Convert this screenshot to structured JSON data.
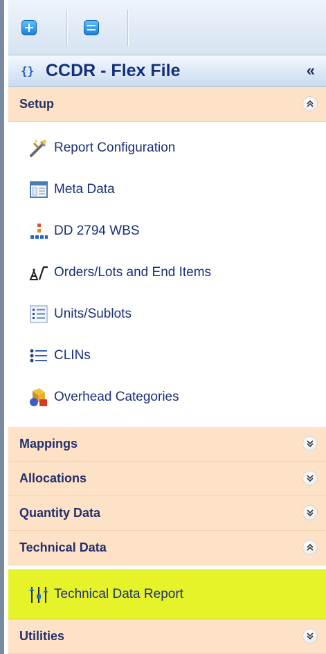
{
  "toolbar": {
    "buttons": [
      {
        "name": "expand-all-icon"
      },
      {
        "name": "collapse-all-icon"
      }
    ]
  },
  "panel": {
    "title": "CCDR - Flex File",
    "code_icon": "{}",
    "collapse_glyph": "«"
  },
  "sections": [
    {
      "label": "Setup",
      "expanded": true
    },
    {
      "label": "Mappings",
      "expanded": false
    },
    {
      "label": "Allocations",
      "expanded": false
    },
    {
      "label": "Quantity Data",
      "expanded": false
    },
    {
      "label": "Technical Data",
      "expanded": true
    },
    {
      "label": "Utilities",
      "expanded": false
    }
  ],
  "chevrons": {
    "up": "⌃",
    "down": "⌄"
  },
  "setup_items": [
    {
      "label": "Report Configuration",
      "icon": "tools-wand-icon"
    },
    {
      "label": "Meta Data",
      "icon": "window-grid-icon"
    },
    {
      "label": "DD 2794 WBS",
      "icon": "hierarchy-icon"
    },
    {
      "label": "Orders/Lots and End Items",
      "icon": "scale-chart-icon"
    },
    {
      "label": "Units/Sublots",
      "icon": "numbered-list-icon"
    },
    {
      "label": "CLINs",
      "icon": "bullet-list-icon"
    },
    {
      "label": "Overhead Categories",
      "icon": "shapes-icon"
    }
  ],
  "technical_items": [
    {
      "label": "Technical Data Report",
      "icon": "sliders-icon",
      "selected": true
    }
  ],
  "colors": {
    "section_bg": "#fde2c7",
    "selected_bg": "#e6f328",
    "title_text": "#12307a",
    "item_text": "#1a2e7a"
  }
}
